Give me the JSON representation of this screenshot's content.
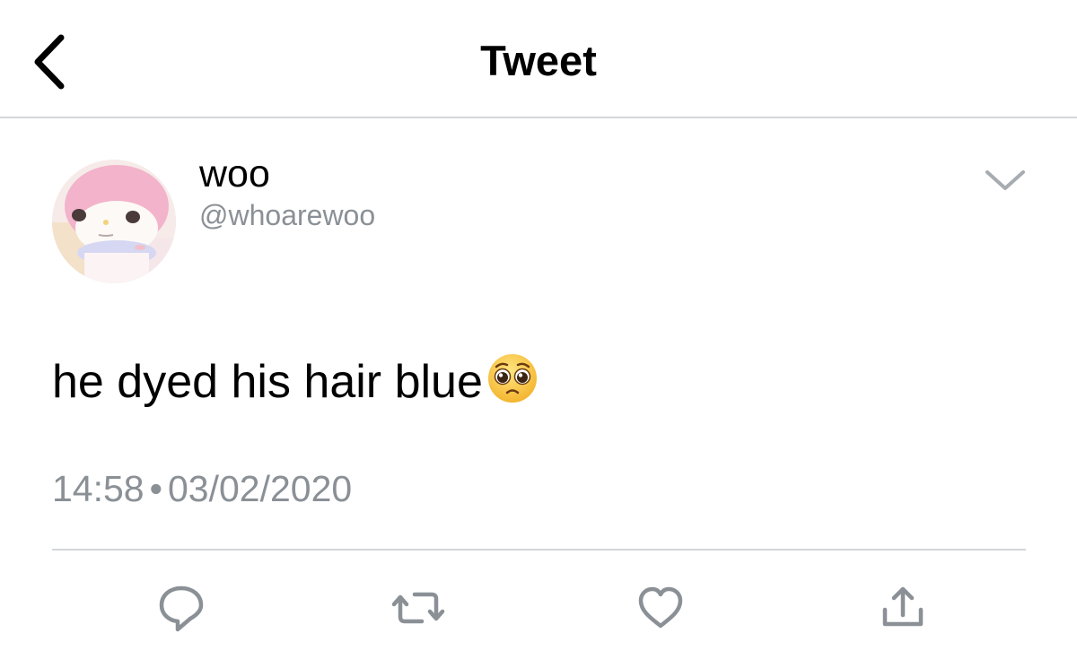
{
  "header": {
    "title": "Tweet",
    "back_icon": "chevron-left-icon"
  },
  "tweet": {
    "author": {
      "display_name": "woo",
      "handle": "@whoarewoo",
      "avatar": "avatar-image"
    },
    "text": "he dyed his hair blue",
    "emoji": "pleading-face-emoji",
    "time": "14:58",
    "separator": "•",
    "date": "03/02/2020",
    "menu_icon": "chevron-down-icon"
  },
  "actions": [
    {
      "name": "reply",
      "icon": "reply-icon"
    },
    {
      "name": "retweet",
      "icon": "retweet-icon"
    },
    {
      "name": "like",
      "icon": "heart-icon"
    },
    {
      "name": "share",
      "icon": "share-icon"
    }
  ],
  "colors": {
    "text": "#000000",
    "secondary": "#8a9096",
    "icon": "#8a9096",
    "divider": "#d4d7da",
    "background": "#ffffff"
  }
}
